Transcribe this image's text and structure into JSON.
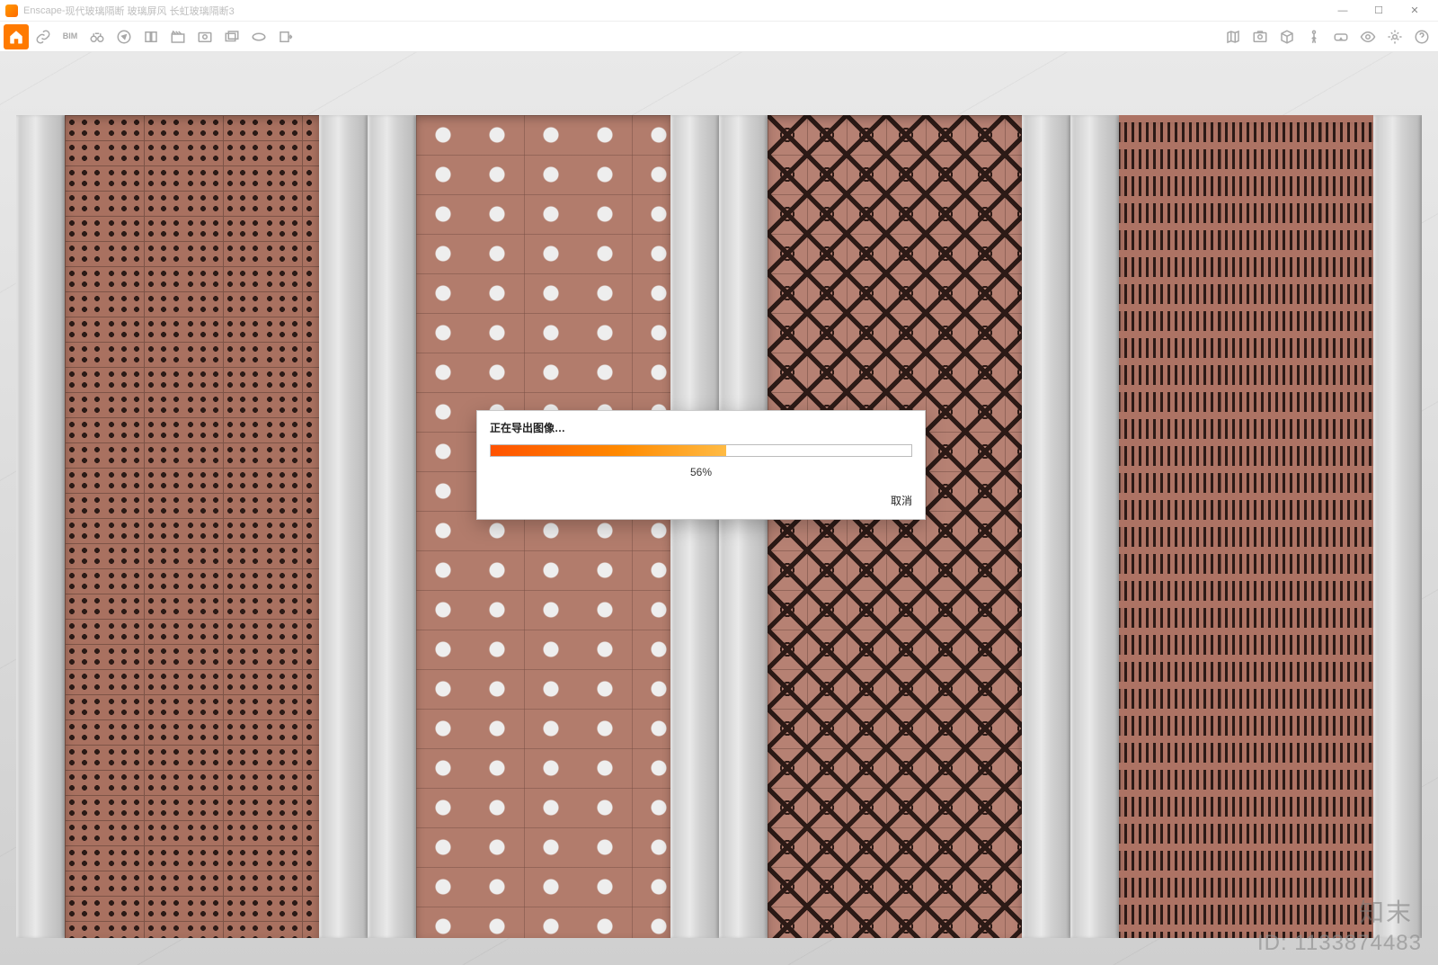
{
  "app": {
    "name": "Enscape",
    "title_sep": " - ",
    "document_title": "现代玻璃隔断 玻璃屏风 长虹玻璃隔断3"
  },
  "window_controls": {
    "minimize": "—",
    "maximize": "☐",
    "close": "✕"
  },
  "toolbar_left": [
    {
      "name": "home-icon"
    },
    {
      "name": "link-icon"
    },
    {
      "name": "bim-icon",
      "label": "BIM"
    },
    {
      "name": "binoculars-icon"
    },
    {
      "name": "compass-icon"
    },
    {
      "name": "layers-icon"
    },
    {
      "name": "clapper-icon"
    },
    {
      "name": "capture-icon"
    },
    {
      "name": "batch-export-icon"
    },
    {
      "name": "pano360-icon"
    },
    {
      "name": "export-icon"
    }
  ],
  "toolbar_right": [
    {
      "name": "map-icon"
    },
    {
      "name": "screenshot-icon"
    },
    {
      "name": "cube-icon"
    },
    {
      "name": "walk-icon"
    },
    {
      "name": "vr-icon"
    },
    {
      "name": "eye-icon"
    },
    {
      "name": "gear-icon"
    },
    {
      "name": "help-icon"
    }
  ],
  "dialog": {
    "title": "正在导出图像…",
    "percent_value": 56,
    "percent_label": "56%",
    "cancel": "取消"
  },
  "watermark": {
    "brand": "知末",
    "id_label": "ID: 1133874483"
  }
}
